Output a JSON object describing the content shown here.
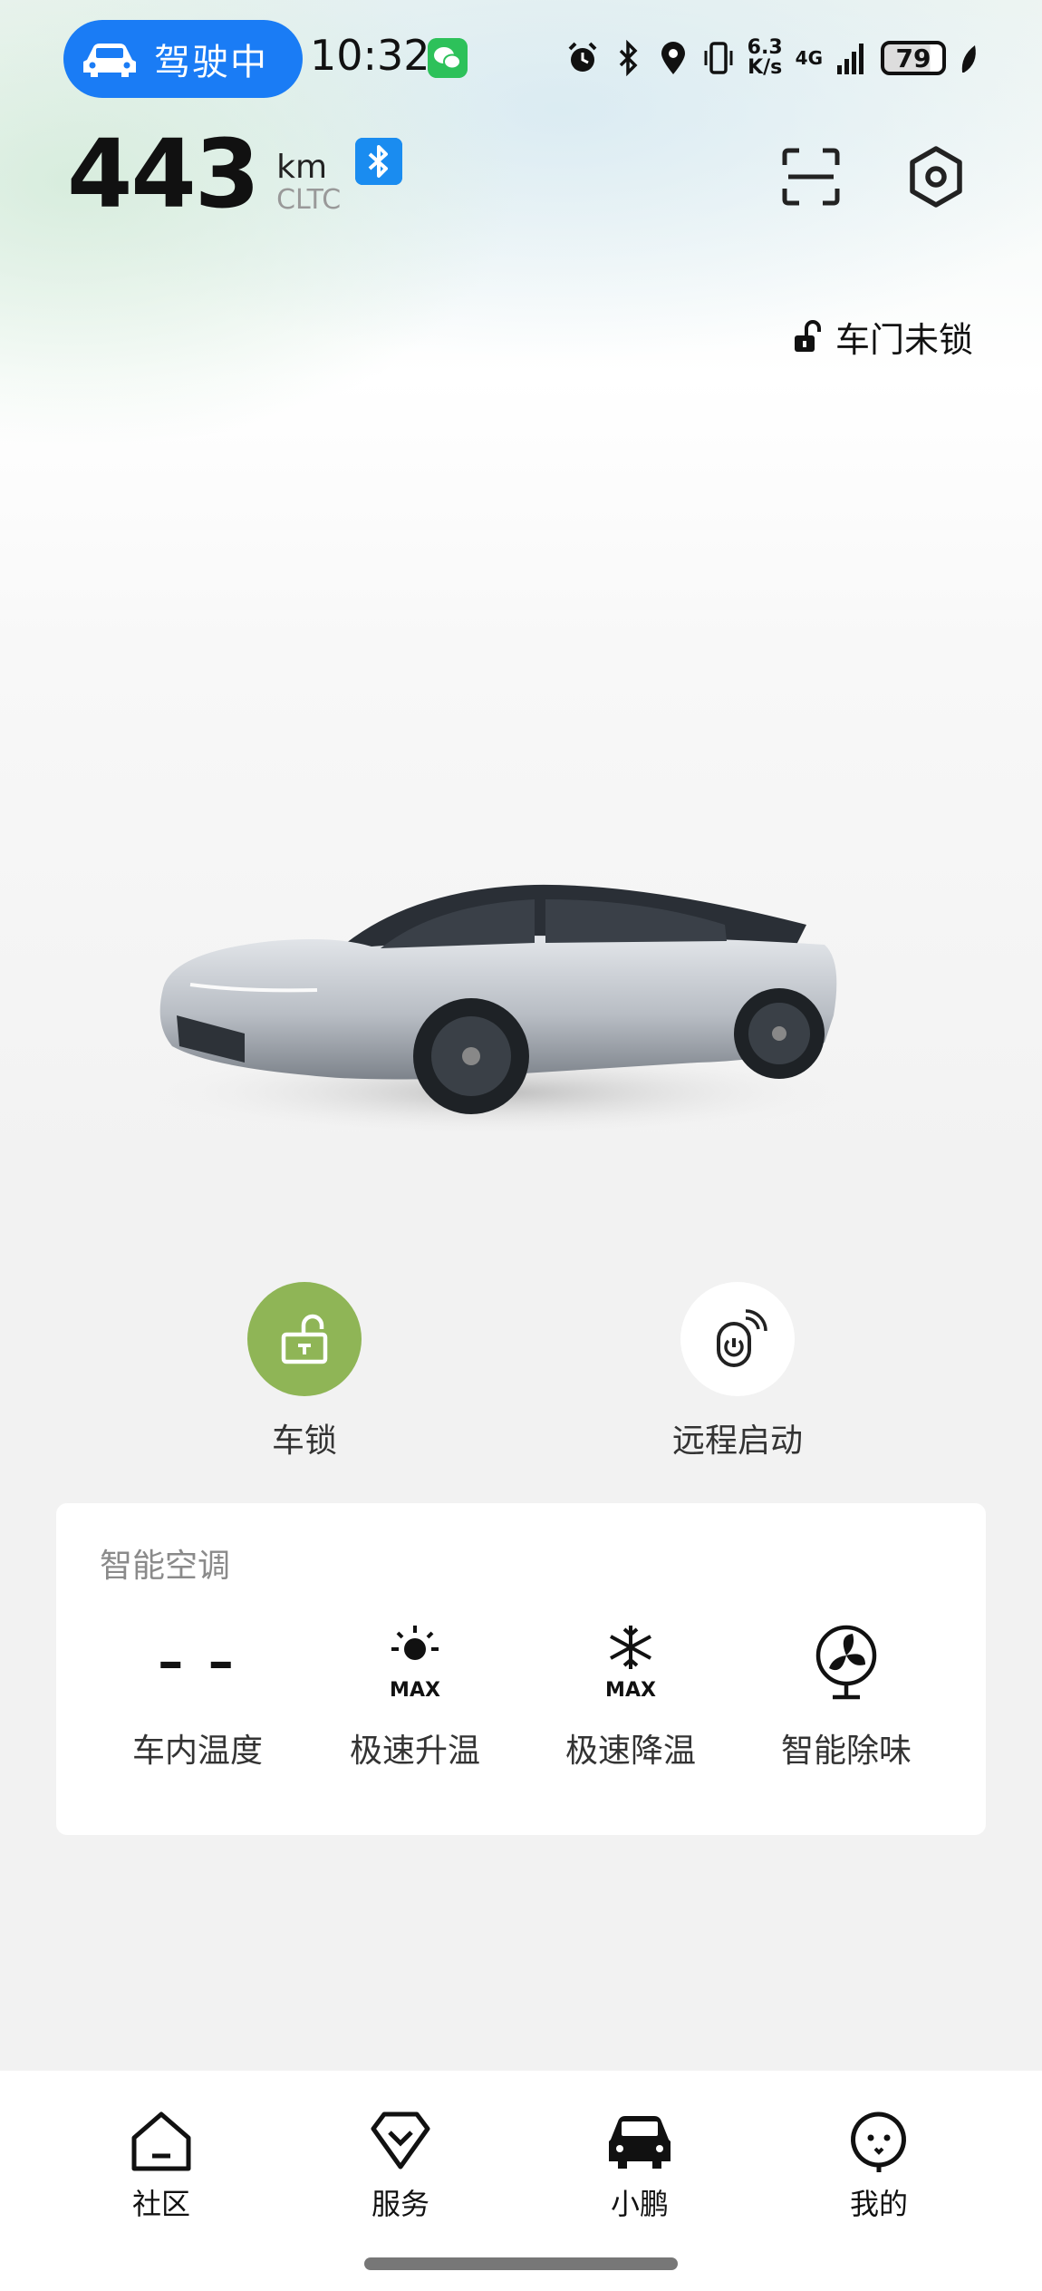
{
  "status_bar": {
    "drive_label": "驾驶中",
    "time": "10:32",
    "net_speed_value": "6.3",
    "net_speed_unit": "K/s",
    "network": "4G",
    "battery": "79"
  },
  "range": {
    "value": "443",
    "unit": "km",
    "standard": "CLTC"
  },
  "door_status": "车门未锁",
  "actions": [
    {
      "label": "车锁"
    },
    {
      "label": "远程启动"
    }
  ],
  "ac": {
    "title": "智能空调",
    "temp_value": "– –",
    "items": [
      {
        "label": "车内温度"
      },
      {
        "label": "极速升温",
        "badge": "MAX"
      },
      {
        "label": "极速降温",
        "badge": "MAX"
      },
      {
        "label": "智能除味"
      }
    ]
  },
  "tabs": [
    {
      "label": "社区"
    },
    {
      "label": "服务"
    },
    {
      "label": "小鹏"
    },
    {
      "label": "我的"
    }
  ],
  "colors": {
    "accent_blue": "#1a7cf5",
    "lock_green": "#8fb556",
    "wechat_green": "#2dc15a"
  }
}
